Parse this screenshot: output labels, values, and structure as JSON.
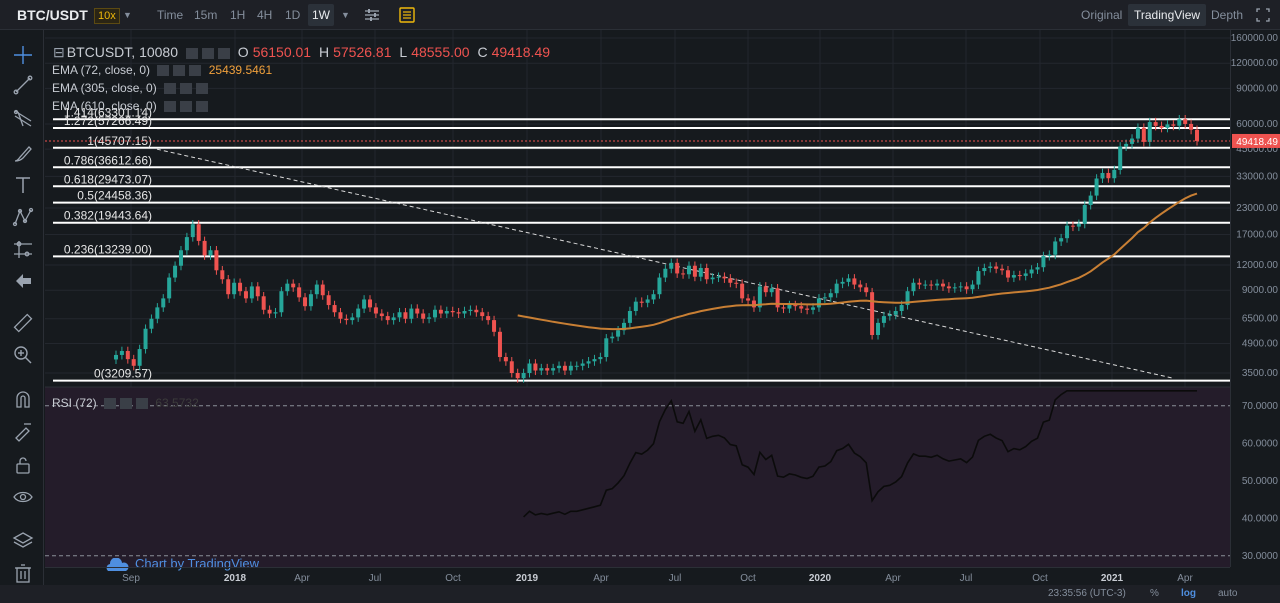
{
  "topbar": {
    "symbol": "BTC/USDT",
    "leverage": "10x",
    "timeframes": [
      "Time",
      "15m",
      "1H",
      "4H",
      "1D",
      "1W"
    ],
    "active_timeframe": "1W",
    "views": [
      "Original",
      "TradingView",
      "Depth"
    ],
    "active_view": "TradingView"
  },
  "legend": {
    "main_symbol": "BTCUSDT, 10080",
    "o_label": "O",
    "o": "56150.01",
    "h_label": "H",
    "h": "57526.81",
    "l_label": "L",
    "l": "48555.00",
    "c_label": "C",
    "c": "49418.49",
    "ema1": "EMA (72, close, 0)",
    "ema1_value": "25439.5461",
    "ema2": "EMA (305, close, 0)",
    "ema3": "EMA (610, close, 0)",
    "rsi": "RSI (72)",
    "rsi_value": "63.5732"
  },
  "watermark": "Chart by TradingView",
  "status": {
    "time": "23:35:56 (UTC-3)",
    "percent": "%",
    "log": "log",
    "auto": "auto"
  },
  "colors": {
    "up": "#26a69a",
    "down": "#ef5350",
    "ema": "#c87f34",
    "fib": "#ffffff",
    "rsi_bg": "#2a1e2c"
  },
  "chart_data": {
    "type": "candlestick",
    "scale": "log",
    "price_ticks": [
      "160000.00",
      "120000.00",
      "90000.00",
      "60000.00",
      "45000.00",
      "33000.00",
      "23000.00",
      "17000.00",
      "12000.00",
      "9000.00",
      "6500.00",
      "4900.00",
      "3500.00"
    ],
    "last_price": "49418.49",
    "time_labels": [
      "Sep",
      "2018",
      "Apr",
      "Jul",
      "Oct",
      "2019",
      "Apr",
      "Jul",
      "Oct",
      "2020",
      "Apr",
      "Jul",
      "Oct",
      "2021",
      "Apr"
    ],
    "fib_levels": [
      {
        "label": "1.414(63301.14)",
        "price": 63301.14
      },
      {
        "label": "1.272(57266.49)",
        "price": 57266.49
      },
      {
        "label": "1(45707.15)",
        "price": 45707.15
      },
      {
        "label": "0.786(36612.66)",
        "price": 36612.66
      },
      {
        "label": "0.618(29473.07)",
        "price": 29473.07
      },
      {
        "label": "0.5(24458.36)",
        "price": 24458.36
      },
      {
        "label": "0.382(19443.64)",
        "price": 19443.64
      },
      {
        "label": "0.236(13239.00)",
        "price": 13239.0
      },
      {
        "label": "0(3209.57)",
        "price": 3209.57
      }
    ],
    "closes": [
      4300,
      4500,
      4100,
      3800,
      4600,
      5800,
      6500,
      7400,
      8200,
      10400,
      11900,
      14200,
      16500,
      19100,
      15800,
      13400,
      14200,
      11300,
      10200,
      8600,
      9800,
      8900,
      8200,
      9400,
      8400,
      7200,
      6900,
      7000,
      8900,
      9700,
      9300,
      8300,
      7500,
      8600,
      9600,
      8500,
      7600,
      7000,
      6500,
      6400,
      6600,
      7300,
      8100,
      7400,
      6900,
      6700,
      6400,
      6600,
      7000,
      6500,
      7300,
      6900,
      6500,
      6600,
      7200,
      6900,
      7100,
      7000,
      6900,
      7100,
      7200,
      7000,
      6700,
      6400,
      5600,
      4200,
      4000,
      3500,
      3300,
      3500,
      3900,
      3600,
      3700,
      3600,
      3700,
      3800,
      3600,
      3800,
      3800,
      3900,
      4000,
      4100,
      4200,
      5200,
      5300,
      5700,
      6200,
      7100,
      7900,
      7800,
      8100,
      8600,
      10400,
      11500,
      12300,
      10900,
      10800,
      11900,
      10500,
      11600,
      10200,
      10400,
      10500,
      10300,
      9800,
      9700,
      8200,
      8000,
      7400,
      9400,
      8800,
      9200,
      7400,
      7300,
      7600,
      7500,
      7300,
      7200,
      7400,
      8200,
      8300,
      8700,
      9700,
      9900,
      10300,
      9600,
      9300,
      8800,
      5400,
      6200,
      6700,
      6800,
      7100,
      7600,
      8900,
      9800,
      9600,
      9600,
      9500,
      9700,
      9400,
      9200,
      9300,
      9400,
      9100,
      9600,
      11200,
      11600,
      11800,
      11500,
      11300,
      10400,
      10700,
      10600,
      10900,
      11400,
      11700,
      13300,
      13500,
      15700,
      16300,
      18800,
      18600,
      19200,
      23800,
      26500,
      32200,
      34300,
      32300,
      35500,
      46400,
      47800,
      50800,
      57500,
      48900,
      61300,
      58700,
      57400,
      59700,
      58800,
      63300,
      60000,
      56150,
      49418
    ],
    "ema": "EMA (72, close, 0) ≈ 25439.5461 at last bar",
    "rsi_levels": [
      "70.0000",
      "60.0000",
      "50.0000",
      "40.0000",
      "30.0000"
    ]
  }
}
